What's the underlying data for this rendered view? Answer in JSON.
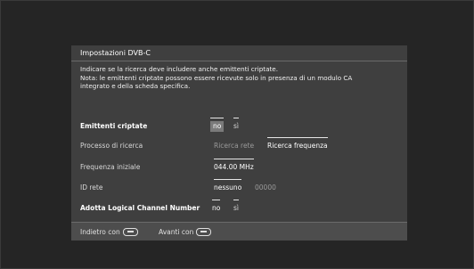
{
  "dialog": {
    "title": "Impostazioni DVB-C",
    "info_line1": "Indicare se la ricerca deve includere anche emittenti criptate.",
    "info_line2": "Nota: le emittenti criptate possono essere ricevute solo in presenza di un modulo CA",
    "info_line3": "integrato e della scheda specifica."
  },
  "settings": {
    "encrypted": {
      "label": "Emittenti criptate",
      "opt1": "no",
      "opt2": "sì",
      "selected": "no"
    },
    "search_process": {
      "label": "Processo di ricerca",
      "opt1": "Ricerca rete",
      "opt2": "Ricerca frequenza",
      "selected": "Ricerca frequenza"
    },
    "start_frequency": {
      "label": "Frequenza iniziale",
      "value": "044.00 MHz"
    },
    "network_id": {
      "label": "ID rete",
      "opt1": "nessuno",
      "opt2": "00000",
      "selected": "nessuno"
    },
    "lcn": {
      "label": "Adotta Logical Channel Number",
      "opt1": "no",
      "opt2": "sì",
      "selected": "no"
    }
  },
  "footer": {
    "back_label": "Indietro con",
    "forward_label": "Avanti con"
  }
}
